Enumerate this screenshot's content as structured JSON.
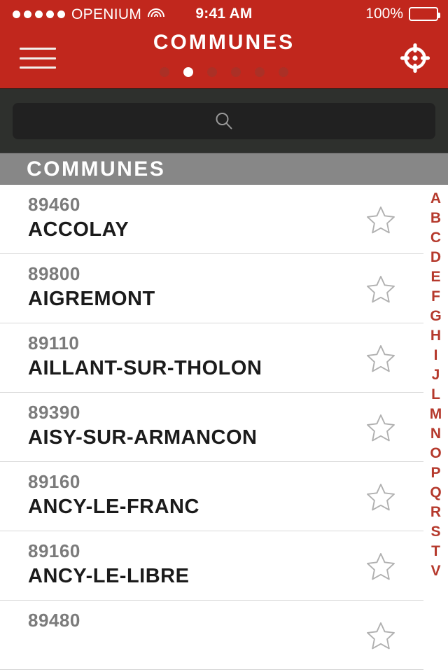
{
  "statusbar": {
    "signal_dots": 5,
    "carrier": "OPENIUM",
    "wifi_icon": "wifi-icon",
    "time": "9:41 AM",
    "battery_percent": "100%",
    "battery_level": 100
  },
  "header": {
    "title": "COMMUNES",
    "menu_icon": "hamburger-menu-icon",
    "locate_icon": "crosshair-target-icon",
    "background_color": "#c1271d",
    "page_dots": {
      "count": 6,
      "active_index": 1
    }
  },
  "search": {
    "icon": "search-magnifier-icon",
    "value": "",
    "placeholder": ""
  },
  "section": {
    "title": "COMMUNES",
    "background_color": "#878787"
  },
  "list": {
    "star_icon": "star-outline-icon",
    "rows": [
      {
        "zip": "89460",
        "name": "ACCOLAY",
        "favorite": false
      },
      {
        "zip": "89800",
        "name": "AIGREMONT",
        "favorite": false
      },
      {
        "zip": "89110",
        "name": "AILLANT-SUR-THOLON",
        "favorite": false
      },
      {
        "zip": "89390",
        "name": "AISY-SUR-ARMANCON",
        "favorite": false
      },
      {
        "zip": "89160",
        "name": "ANCY-LE-FRANC",
        "favorite": false
      },
      {
        "zip": "89160",
        "name": "ANCY-LE-LIBRE",
        "favorite": false
      },
      {
        "zip": "89480",
        "name": "",
        "favorite": false
      }
    ]
  },
  "alpha_index": {
    "color": "#b5392c",
    "letters": [
      "A",
      "B",
      "C",
      "D",
      "E",
      "F",
      "G",
      "H",
      "I",
      "J",
      "L",
      "M",
      "N",
      "O",
      "P",
      "Q",
      "R",
      "S",
      "T",
      "V"
    ]
  }
}
